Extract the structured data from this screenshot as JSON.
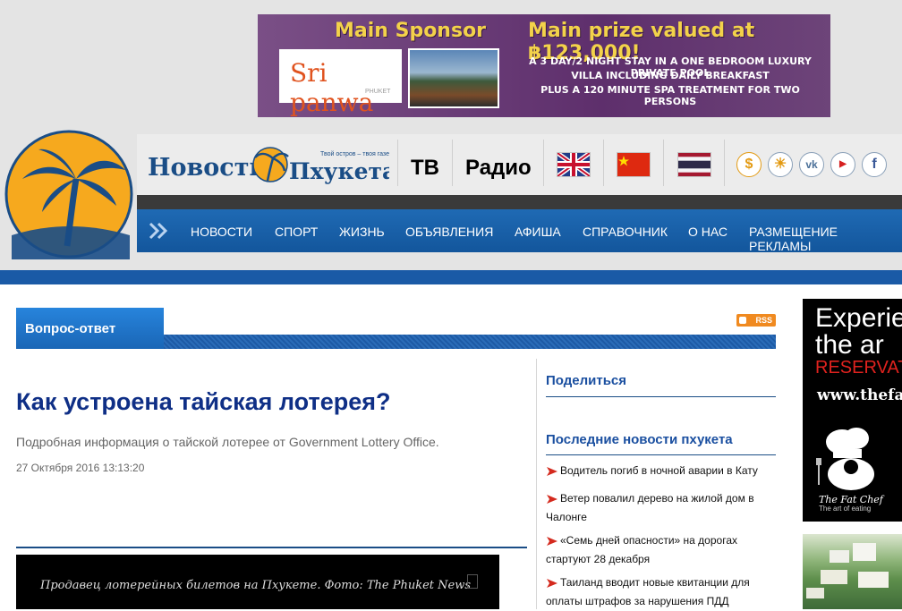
{
  "banner": {
    "main_sponsor": "Main Sponsor",
    "main_prize": "Main prize valued at ฿123,000!",
    "line1": "A 3 DAY/2 NIGHT  STAY IN A ONE BEDROOM LUXURY PRIVATE POOL",
    "line2": "VILLA  INCLUDING DAILY BREAKFAST",
    "line3": "PLUS A 120 MINUTE SPA TREATMENT  FOR TWO PERSONS",
    "brand": "Sri panwa",
    "brand_sub": "PHUKET"
  },
  "header": {
    "site_name": "Новости Пхукета",
    "slogan": "Твой остров – твоя газета",
    "tv": "ТВ",
    "radio": "Радио",
    "flags": [
      "uk-flag",
      "china-flag",
      "thailand-flag"
    ],
    "social_icons": [
      "currency-icon",
      "weather-icon",
      "vk-icon",
      "youtube-icon",
      "facebook-icon"
    ]
  },
  "nav": {
    "items": [
      "Новости",
      "Спорт",
      "Жизнь",
      "Объявления",
      "Афиша",
      "Справочник",
      "О нас",
      "Размещение рекламы"
    ]
  },
  "section": {
    "title": "Вопрос-ответ",
    "rss": "RSS"
  },
  "article": {
    "title": "Как устроена тайская лотерея?",
    "lead": "Подробная информация о тайской лотерее от Government Lottery Office.",
    "date": "27 Октября 2016 13:13:20",
    "photo_caption": "Продавец лотерейных билетов на Пхукете. Фото: The Phuket News"
  },
  "sidebar": {
    "share": "Поделиться",
    "latest_title": "Последние новости пхукета",
    "news": [
      "Водитель погиб в ночной аварии в Кату",
      "Ветер повалил дерево на жилой дом в Чалонге",
      "«Семь дней опасности» на дорогах стартуют 28 декабря",
      "Таиланд вводит новые квитанции для оплаты штрафов за нарушения ПДД"
    ]
  },
  "side_ad": {
    "line1": "Experie",
    "line2": "the ar",
    "reserve": "RESERVAT",
    "url": "www.thefa",
    "brand": "The Fat Chef",
    "tag": "The art of eating"
  },
  "colors": {
    "brand_blue": "#1a5aa6",
    "title_blue": "#0f2f86",
    "logo_orange": "#f6a91e"
  }
}
